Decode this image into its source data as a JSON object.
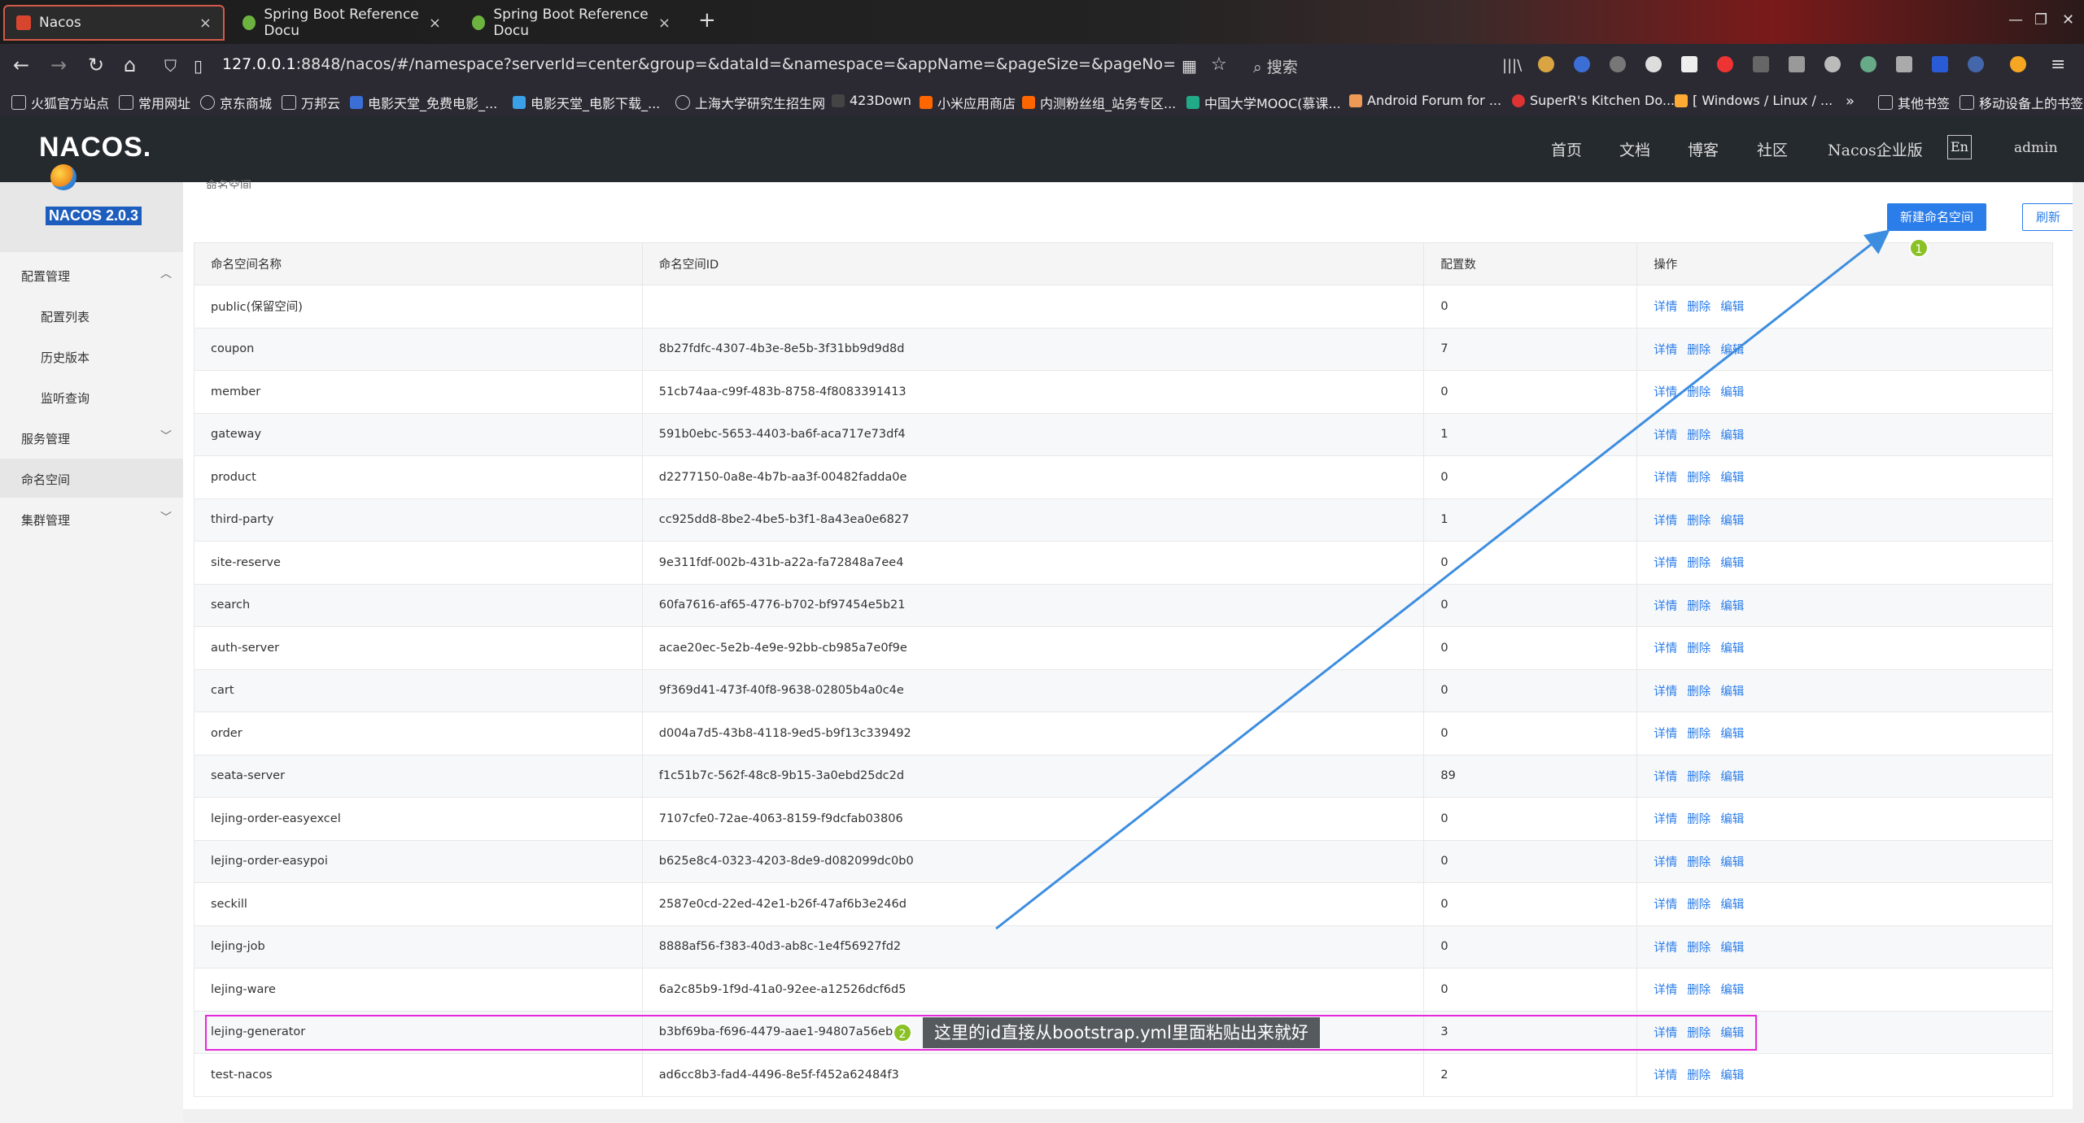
{
  "browser": {
    "tabs": [
      {
        "title": "Nacos",
        "active": true
      },
      {
        "title": "Spring Boot Reference Docu",
        "active": false
      },
      {
        "title": "Spring Boot Reference Docu",
        "active": false
      }
    ],
    "url_host": "127.0.0.1",
    "url_rest": ":8848/nacos/#/namespace?serverId=center&group=&dataId=&namespace=&appName=&pageSize=&pageNo=",
    "search_placeholder": "搜索",
    "bookmarks": [
      "火狐官方站点",
      "常用网址",
      "京东商城",
      "万邦云",
      "电影天堂_免费电影_...",
      "电影天堂_电影下载_...",
      "上海大学研究生招生网",
      "423Down",
      "小米应用商店",
      "内测粉丝组_站务专区...",
      "中国大学MOOC(慕课...",
      "Android Forum for ...",
      "SuperR's Kitchen Do...",
      "[ Windows / Linux / ...",
      "其他书签",
      "移动设备上的书签"
    ]
  },
  "header": {
    "logo": "NACOS.",
    "nav": [
      "首页",
      "文档",
      "博客",
      "社区",
      "Nacos企业版"
    ],
    "lang": "En",
    "user": "admin"
  },
  "sidebar": {
    "version": "NACOS 2.0.3",
    "items": [
      {
        "label": "配置管理",
        "chev": "^"
      },
      {
        "label": "配置列表",
        "chev": ""
      },
      {
        "label": "历史版本",
        "chev": ""
      },
      {
        "label": "监听查询",
        "chev": ""
      },
      {
        "label": "服务管理",
        "chev": "v"
      },
      {
        "label": "命名空间",
        "chev": ""
      },
      {
        "label": "集群管理",
        "chev": "v"
      }
    ]
  },
  "main": {
    "breadcrumb": "命名空间",
    "new_button": "新建命名空间",
    "refresh_button": "刷新",
    "columns": [
      "命名空间名称",
      "命名空间ID",
      "配置数",
      "操作"
    ],
    "ops": [
      "详情",
      "删除",
      "编辑"
    ],
    "rows": [
      {
        "name": "public(保留空间)",
        "id": "",
        "count": "0"
      },
      {
        "name": "coupon",
        "id": "8b27fdfc-4307-4b3e-8e5b-3f31bb9d9d8d",
        "count": "7"
      },
      {
        "name": "member",
        "id": "51cb74aa-c99f-483b-8758-4f8083391413",
        "count": "0"
      },
      {
        "name": "gateway",
        "id": "591b0ebc-5653-4403-ba6f-aca717e73df4",
        "count": "1"
      },
      {
        "name": "product",
        "id": "d2277150-0a8e-4b7b-aa3f-00482fadda0e",
        "count": "0"
      },
      {
        "name": "third-party",
        "id": "cc925dd8-8be2-4be5-b3f1-8a43ea0e6827",
        "count": "1"
      },
      {
        "name": "site-reserve",
        "id": "9e311fdf-002b-431b-a22a-fa72848a7ee4",
        "count": "0"
      },
      {
        "name": "search",
        "id": "60fa7616-af65-4776-b702-bf97454e5b21",
        "count": "0"
      },
      {
        "name": "auth-server",
        "id": "acae20ec-5e2b-4e9e-92bb-cb985a7e0f9e",
        "count": "0"
      },
      {
        "name": "cart",
        "id": "9f369d41-473f-40f8-9638-02805b4a0c4e",
        "count": "0"
      },
      {
        "name": "order",
        "id": "d004a7d5-43b8-4118-9ed5-b9f13c339492",
        "count": "0"
      },
      {
        "name": "seata-server",
        "id": "f1c51b7c-562f-48c8-9b15-3a0ebd25dc2d",
        "count": "89"
      },
      {
        "name": "lejing-order-easyexcel",
        "id": "7107cfe0-72ae-4063-8159-f9dcfab03806",
        "count": "0"
      },
      {
        "name": "lejing-order-easypoi",
        "id": "b625e8c4-0323-4203-8de9-d082099dc0b0",
        "count": "0"
      },
      {
        "name": "seckill",
        "id": "2587e0cd-22ed-42e1-b26f-47af6b3e246d",
        "count": "0"
      },
      {
        "name": "lejing-job",
        "id": "8888af56-f383-40d3-ab8c-1e4f56927fd2",
        "count": "0"
      },
      {
        "name": "lejing-ware",
        "id": "6a2c85b9-1f9d-41a0-92ee-a12526dcf6d5",
        "count": "0"
      },
      {
        "name": "lejing-generator",
        "id": "b3bf69ba-f696-4479-aae1-94807a56eb90",
        "count": "3"
      },
      {
        "name": "test-nacos",
        "id": "ad6cc8b3-fad4-4496-8e5f-f452a62484f3",
        "count": "2"
      }
    ]
  },
  "annotations": {
    "badge1": "1",
    "badge2": "2",
    "note": "这里的id直接从bootstrap.yml里面粘贴出来就好",
    "colors": {
      "arrow": "#3c8de0",
      "highlight": "#e62ad9",
      "badge": "#8ac225"
    }
  }
}
